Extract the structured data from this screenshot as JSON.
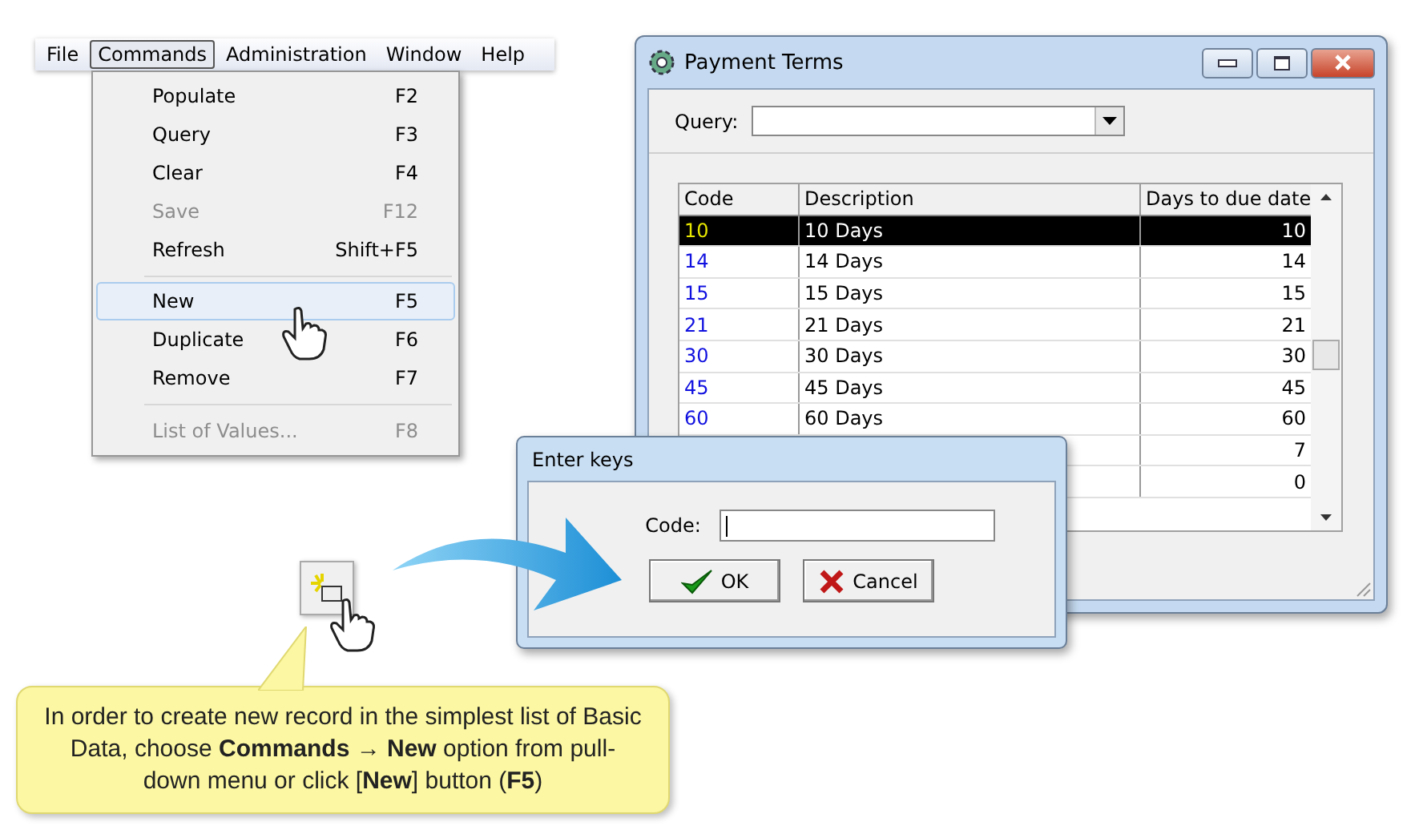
{
  "menu_bar": [
    {
      "label": "File",
      "selected": false
    },
    {
      "label": "Commands",
      "selected": true
    },
    {
      "label": "Administration",
      "selected": false
    },
    {
      "label": "Window",
      "selected": false
    },
    {
      "label": "Help",
      "selected": false
    }
  ],
  "commands_menu": [
    {
      "kind": "item",
      "label": "Populate",
      "shortcut": "F2",
      "disabled": false,
      "selected": false
    },
    {
      "kind": "item",
      "label": "Query",
      "shortcut": "F3",
      "disabled": false,
      "selected": false
    },
    {
      "kind": "item",
      "label": "Clear",
      "shortcut": "F4",
      "disabled": false,
      "selected": false
    },
    {
      "kind": "item",
      "label": "Save",
      "shortcut": "F12",
      "disabled": true,
      "selected": false
    },
    {
      "kind": "item",
      "label": "Refresh",
      "shortcut": "Shift+F5",
      "disabled": false,
      "selected": false
    },
    {
      "kind": "separator"
    },
    {
      "kind": "item",
      "label": "New",
      "shortcut": "F5",
      "disabled": false,
      "selected": true
    },
    {
      "kind": "item",
      "label": "Duplicate",
      "shortcut": "F6",
      "disabled": false,
      "selected": false
    },
    {
      "kind": "item",
      "label": "Remove",
      "shortcut": "F7",
      "disabled": false,
      "selected": false
    },
    {
      "kind": "separator"
    },
    {
      "kind": "item",
      "label": "List of Values...",
      "shortcut": "F8",
      "disabled": true,
      "selected": false
    }
  ],
  "payment_terms_window": {
    "title": "Payment Terms",
    "query_label": "Query:",
    "table": {
      "columns": [
        "Code",
        "Description",
        "Days to due date"
      ],
      "rows": [
        {
          "code": "10",
          "description": "10 Days",
          "days": "10",
          "selected": true
        },
        {
          "code": "14",
          "description": "14 Days",
          "days": "14",
          "selected": false
        },
        {
          "code": "15",
          "description": "15 Days",
          "days": "15",
          "selected": false
        },
        {
          "code": "21",
          "description": "21 Days",
          "days": "21",
          "selected": false
        },
        {
          "code": "30",
          "description": "30 Days",
          "days": "30",
          "selected": false
        },
        {
          "code": "45",
          "description": "45 Days",
          "days": "45",
          "selected": false
        },
        {
          "code": "60",
          "description": "60 Days",
          "days": "60",
          "selected": false
        },
        {
          "days": "7",
          "selected": false
        },
        {
          "days": "0",
          "selected": false
        }
      ]
    }
  },
  "enter_keys_dialog": {
    "title": "Enter keys",
    "field_label": "Code:",
    "buttons": [
      {
        "kind": "ok",
        "label": "OK"
      },
      {
        "kind": "cancel",
        "label": "Cancel"
      }
    ]
  },
  "callout": {
    "text": "In order to create new record in the simplest list of Basic Data, choose **Commands → New** option from pull-down menu or click [**New**] button (**F5**)"
  }
}
